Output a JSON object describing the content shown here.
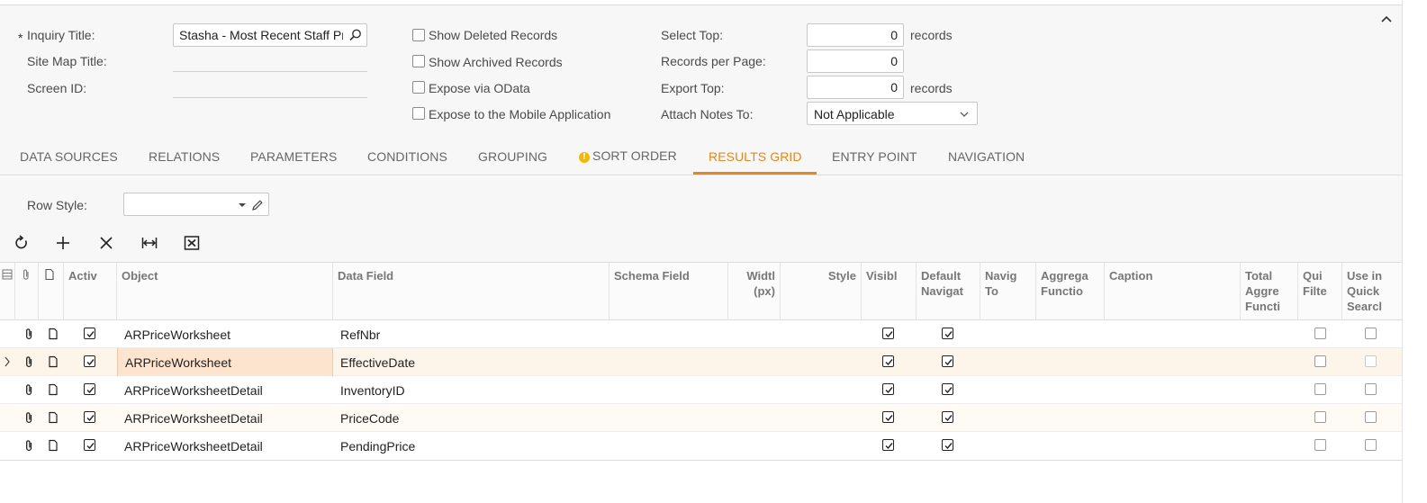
{
  "summary": {
    "inquiry_title_label": "Inquiry Title:",
    "inquiry_title_required": "*",
    "inquiry_title_value": "Stasha - Most Recent Staff Pri",
    "site_map_title_label": "Site Map Title:",
    "screen_id_label": "Screen ID:",
    "show_deleted_label": "Show Deleted Records",
    "show_archived_label": "Show Archived Records",
    "expose_odata_label": "Expose via OData",
    "expose_mobile_label": "Expose to the Mobile Application",
    "select_top_label": "Select Top:",
    "select_top_value": "0",
    "select_top_unit": "records",
    "records_per_page_label": "Records per Page:",
    "records_per_page_value": "0",
    "export_top_label": "Export Top:",
    "export_top_value": "0",
    "export_top_unit": "records",
    "attach_notes_label": "Attach Notes To:",
    "attach_notes_value": "Not Applicable"
  },
  "tabs": [
    {
      "label": "DATA SOURCES"
    },
    {
      "label": "RELATIONS"
    },
    {
      "label": "PARAMETERS"
    },
    {
      "label": "CONDITIONS"
    },
    {
      "label": "GROUPING"
    },
    {
      "label": "SORT ORDER",
      "warning": "!"
    },
    {
      "label": "RESULTS GRID",
      "active": true
    },
    {
      "label": "ENTRY POINT"
    },
    {
      "label": "NAVIGATION"
    }
  ],
  "row_style": {
    "label": "Row Style:",
    "value": ""
  },
  "grid": {
    "headers": {
      "active": "Activ",
      "object": "Object",
      "data_field": "Data Field",
      "schema_field": "Schema Field",
      "width": "Widtl (px)",
      "style": "Style",
      "visible": "Visibl",
      "default_nav": "Default Navigat",
      "navig_to": "Navig To",
      "aggregate": "Aggrega Functio",
      "caption": "Caption",
      "total_aggr": "Total Aggre Functi",
      "quick_filter": "Qui Filte",
      "quick_search": "Use in Quick Searcl"
    },
    "rows": [
      {
        "object": "ARPriceWorksheet",
        "data_field": "RefNbr",
        "active": true,
        "visible": true,
        "default_nav": true
      },
      {
        "object": "ARPriceWorksheet",
        "data_field": "EffectiveDate",
        "active": true,
        "visible": true,
        "default_nav": true
      },
      {
        "object": "ARPriceWorksheetDetail",
        "data_field": "InventoryID",
        "active": true,
        "visible": true,
        "default_nav": true
      },
      {
        "object": "ARPriceWorksheetDetail",
        "data_field": "PriceCode",
        "active": true,
        "visible": true,
        "default_nav": true
      },
      {
        "object": "ARPriceWorksheetDetail",
        "data_field": "PendingPrice",
        "active": true,
        "visible": true,
        "default_nav": true
      }
    ]
  },
  "colors": {
    "accent": "#e3871f",
    "warning": "#f5b800",
    "selected_row": "#fdf4ea",
    "selected_cell": "#fde4cf"
  }
}
